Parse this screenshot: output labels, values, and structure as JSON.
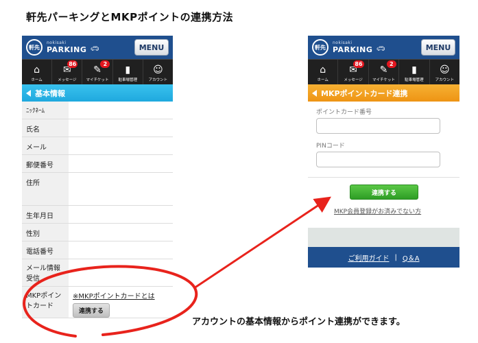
{
  "page_title": "軒先パーキングとMKPポイントの連携方法",
  "caption": "アカウントの基本情報からポイント連携ができます。",
  "header": {
    "logo_mark": "軒先",
    "logo_small": "nokisaki",
    "logo_text": "PARKING",
    "menu_label": "MENU"
  },
  "nav": [
    {
      "label": "ホーム",
      "icon": "home-icon",
      "glyph": "⌂",
      "badge": ""
    },
    {
      "label": "メッセージ",
      "icon": "chat-icon",
      "glyph": "✉",
      "badge": "86"
    },
    {
      "label": "マイチケット",
      "icon": "ticket-icon",
      "glyph": "✎",
      "badge": "2"
    },
    {
      "label": "駐車場管理",
      "icon": "bookmark-icon",
      "glyph": "▮",
      "badge": ""
    },
    {
      "label": "アカウント",
      "icon": "smiley-icon",
      "glyph": "☺",
      "badge": ""
    }
  ],
  "left_screen": {
    "section_title": "基本情報",
    "rows": [
      {
        "label": "ﾆｯｸﾈｰﾑ"
      },
      {
        "label": "氏名"
      },
      {
        "label": "メール"
      },
      {
        "label": "郵便番号"
      },
      {
        "label": "住所"
      },
      {
        "label": "生年月日"
      },
      {
        "label": "性別"
      },
      {
        "label": "電話番号"
      },
      {
        "label": "メール情報受信"
      },
      {
        "label": "MKPポイントカード"
      }
    ],
    "mkp_link": "※MKPポイントカードとは",
    "link_button": "連携する"
  },
  "right_screen": {
    "section_title": "MKPポイントカード連携",
    "card_number_label": "ポイントカード番号",
    "pin_label": "PINコード",
    "submit_label": "連携する",
    "register_link": "MKP会員登録がお済みでない方",
    "footer_guide": "ご利用ガイド",
    "footer_sep": "|",
    "footer_qa": "Q＆A"
  },
  "colors": {
    "header_blue": "#1f4f8e",
    "section_blue": "#1fa9de",
    "section_orange": "#ee9414",
    "annotation_red": "#e8231c",
    "button_green": "#2e9e25",
    "badge_red": "#e3161f"
  }
}
